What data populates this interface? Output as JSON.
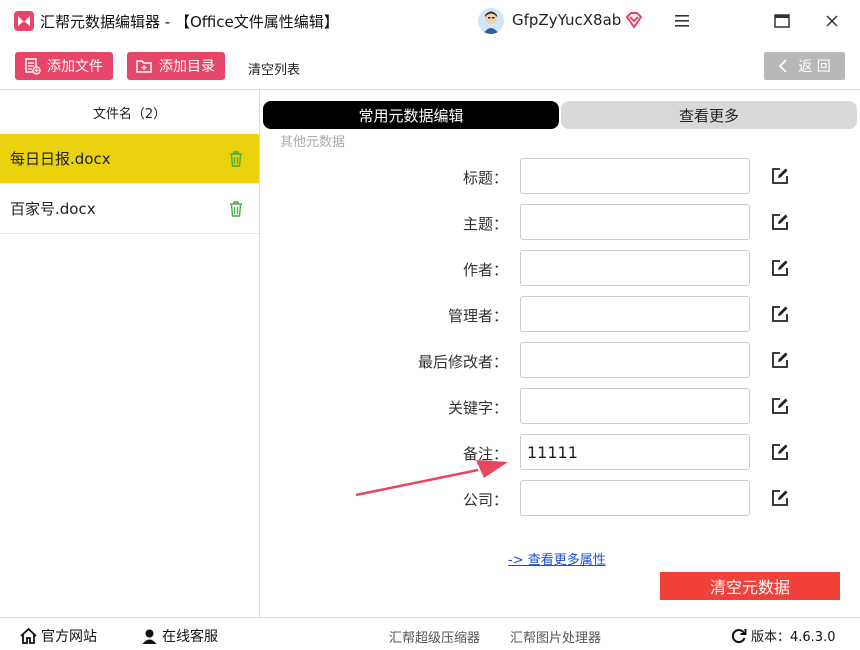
{
  "window": {
    "title": "汇帮元数据编辑器 - 【Office文件属性编辑】",
    "username": "GfpZyYucX8ab",
    "icons": [
      "app-logo-icon",
      "vip-diamond-icon",
      "menu-icon",
      "maximize-icon",
      "close-icon"
    ]
  },
  "toolbar": {
    "add_file": "添加文件",
    "add_dir": "添加目录",
    "clear_list": "清空列表",
    "back": "返 回"
  },
  "file_list": {
    "header": "文件名（2）",
    "items": [
      {
        "name": "每日日报.docx",
        "selected": true
      },
      {
        "name": "百家号.docx",
        "selected": false
      }
    ]
  },
  "tabs": {
    "common": "常用元数据编辑",
    "more": "查看更多",
    "sub_label": "其他元数据"
  },
  "fields": [
    {
      "label": "标题：",
      "value": ""
    },
    {
      "label": "主题：",
      "value": ""
    },
    {
      "label": "作者：",
      "value": ""
    },
    {
      "label": "管理者：",
      "value": ""
    },
    {
      "label": "最后修改者：",
      "value": ""
    },
    {
      "label": "关键字：",
      "value": ""
    },
    {
      "label": "备注：",
      "value": "11111"
    },
    {
      "label": "公司：",
      "value": ""
    }
  ],
  "more_link": "-> 查看更多属性",
  "clear_meta": "清空元数据",
  "footer": {
    "website": "官方网站",
    "support": "在线客服",
    "compressor": "汇帮超级压缩器",
    "image_tool": "汇帮图片处理器",
    "version": "版本：4.6.3.0"
  },
  "colors": {
    "accent_pink": "#e8456a",
    "selected_row": "#ecd10d",
    "clear_button": "#f2413b",
    "annotation_arrow": "#e8465f"
  }
}
